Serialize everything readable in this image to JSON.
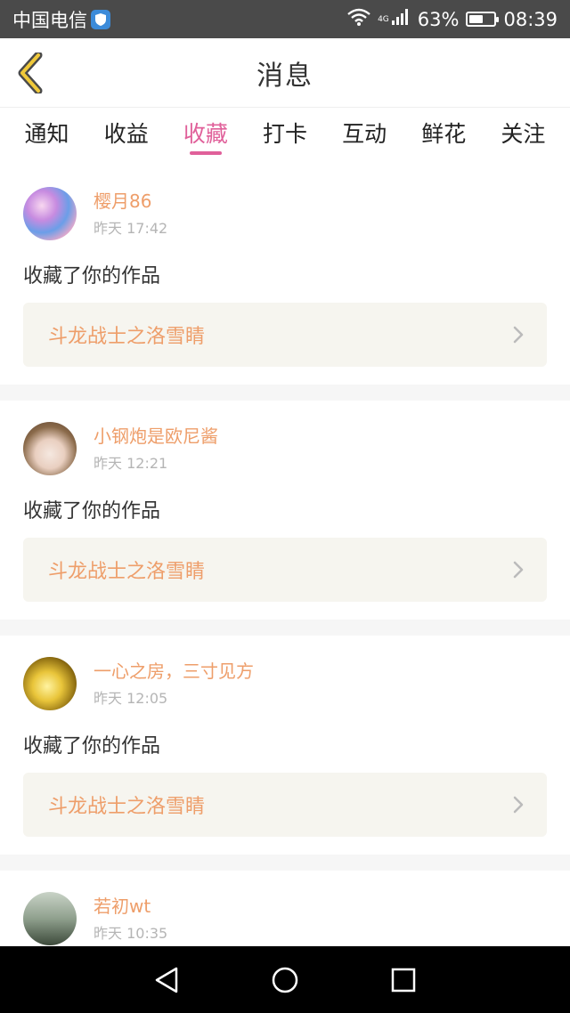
{
  "status_bar": {
    "carrier": "中国电信",
    "network": "4G",
    "battery": "63%",
    "battery_level": 0.63,
    "time": "08:39"
  },
  "header": {
    "title": "消息"
  },
  "tabs": [
    {
      "label": "通知",
      "active": false
    },
    {
      "label": "收益",
      "active": false
    },
    {
      "label": "收藏",
      "active": true
    },
    {
      "label": "打卡",
      "active": false
    },
    {
      "label": "互动",
      "active": false
    },
    {
      "label": "鲜花",
      "active": false
    },
    {
      "label": "关注",
      "active": false
    }
  ],
  "messages": [
    {
      "user": "樱月86",
      "time": "昨天 17:42",
      "action": "收藏了你的作品",
      "work": "斗龙战士之洛雪睛"
    },
    {
      "user": "小钢炮是欧尼酱",
      "time": "昨天 12:21",
      "action": "收藏了你的作品",
      "work": "斗龙战士之洛雪睛"
    },
    {
      "user": "一心之房，三寸见方",
      "time": "昨天 12:05",
      "action": "收藏了你的作品",
      "work": "斗龙战士之洛雪睛"
    },
    {
      "user": "若初wt",
      "time": "昨天 10:35"
    }
  ],
  "colors": {
    "accent": "#e0609a",
    "username": "#ee9e6a",
    "work_bg": "#f6f5ef"
  },
  "icons": {
    "back": "chevron-left-icon",
    "nav_back": "triangle-back-icon",
    "nav_home": "circle-home-icon",
    "nav_recent": "square-recent-icon"
  }
}
